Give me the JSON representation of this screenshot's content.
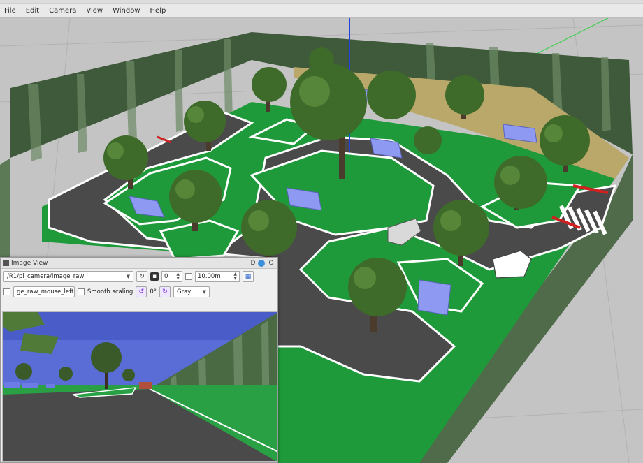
{
  "menubar": {
    "items": [
      "File",
      "Edit",
      "Camera",
      "View",
      "Window",
      "Help"
    ]
  },
  "image_view": {
    "title": "Image View",
    "title_buttons": [
      "D",
      "O"
    ],
    "topic_value": "/R1/pi_camera/image_raw",
    "refresh_icon": "refresh-icon",
    "zoom_value": "0",
    "distance_value": "10.00m",
    "mouse_topic_value": "ge_raw_mouse_left",
    "smooth_label": "Smooth scaling",
    "rotation_value": "0°",
    "colormap_value": "Gray"
  },
  "colors": {
    "grass": "#1f9a3a",
    "road": "#4a4a4a",
    "wall_forest": "#3f5a3a",
    "car_blue": "#8e9af2",
    "tree": "#3f6b2a",
    "accent_purple": "#7a3ad9"
  }
}
